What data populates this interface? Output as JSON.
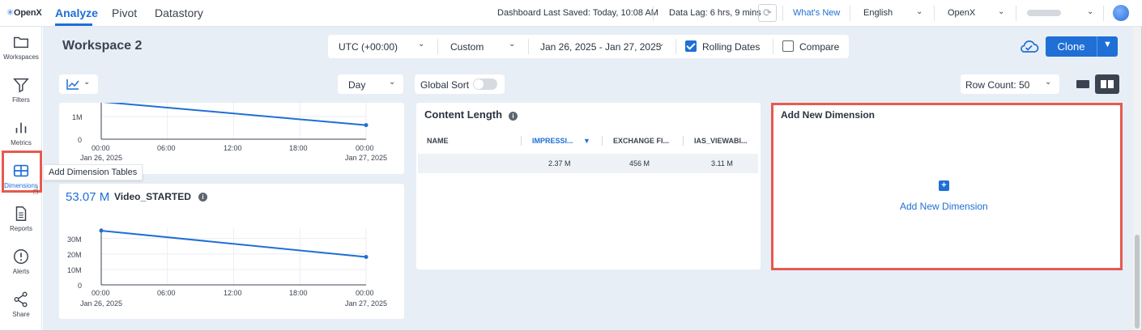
{
  "app": {
    "logo": "OpenX",
    "nav_tabs": [
      {
        "label": "Analyze",
        "active": true
      },
      {
        "label": "Pivot",
        "active": false
      },
      {
        "label": "Datastory",
        "active": false
      }
    ],
    "dashboard_saved": "Dashboard Last Saved: Today, 10:08 AM",
    "data_lag": "Data Lag: 6 hrs, 9 mins",
    "whats_new": "What's New",
    "language": "English",
    "account": "OpenX"
  },
  "sidebar": {
    "items": [
      {
        "label": "Workspaces",
        "icon": "folder-icon"
      },
      {
        "label": "Filters",
        "icon": "filter-icon"
      },
      {
        "label": "Metrics",
        "icon": "bar-chart-icon"
      },
      {
        "label": "Dimensions",
        "icon": "table-icon",
        "active": true
      },
      {
        "label": "Reports",
        "icon": "document-icon"
      },
      {
        "label": "Alerts",
        "icon": "alert-icon"
      },
      {
        "label": "Share",
        "icon": "share-icon"
      }
    ],
    "tooltip": "Add Dimension Tables"
  },
  "toolbar": {
    "workspace_title": "Workspace 2",
    "timezone": "UTC (+00:00)",
    "range_type": "Custom",
    "date_range": "Jan 26, 2025 - Jan 27, 2025",
    "rolling_dates_label": "Rolling Dates",
    "rolling_dates_checked": true,
    "compare_label": "Compare",
    "compare_checked": false,
    "clone_label": "Clone",
    "granularity": "Day",
    "global_sort_label": "Global Sort",
    "row_count_label": "Row Count:",
    "row_count_value": "50"
  },
  "colors": {
    "accent": "#1f6fd6",
    "highlight": "#e65a4f",
    "background": "#e8eef6"
  },
  "charts": {
    "top_chart": {
      "y_ticks": [
        "1M",
        "0"
      ],
      "x_ticks": [
        "00:00",
        "06:00",
        "12:00",
        "18:00",
        "00:00"
      ],
      "x_dates": [
        "Jan 26, 2025",
        "Jan 27, 2025"
      ]
    },
    "video_started": {
      "metric_value": "53.07 M",
      "metric_name": "Video_STARTED",
      "y_ticks": [
        "30M",
        "20M",
        "10M",
        "0"
      ],
      "x_ticks": [
        "00:00",
        "06:00",
        "12:00",
        "18:00",
        "00:00"
      ],
      "x_dates": [
        "Jan 26, 2025",
        "Jan 27, 2025"
      ]
    }
  },
  "chart_data": [
    {
      "type": "line",
      "title": "",
      "x": [
        "Jan 26, 2025",
        "Jan 27, 2025"
      ],
      "values": [
        1650000,
        620000
      ],
      "xlabel": "",
      "ylabel": "",
      "ylim": [
        0,
        1500000
      ],
      "grid": true
    },
    {
      "type": "line",
      "title": "Video_STARTED",
      "x": [
        "Jan 26, 2025",
        "Jan 27, 2025"
      ],
      "values": [
        35000000,
        18000000
      ],
      "xlabel": "",
      "ylabel": "",
      "ylim": [
        0,
        35000000
      ],
      "grid": true
    }
  ],
  "content_length": {
    "title": "Content Length",
    "columns": [
      "NAME",
      "IMPRESSI...",
      "EXCHANGE FI...",
      "IAS_VIEWABI..."
    ],
    "rows": [
      [
        "",
        "2.37 M",
        "456 M",
        "3.11 M"
      ]
    ]
  },
  "new_dimension": {
    "title": "Add New Dimension",
    "link": "Add New Dimension"
  }
}
